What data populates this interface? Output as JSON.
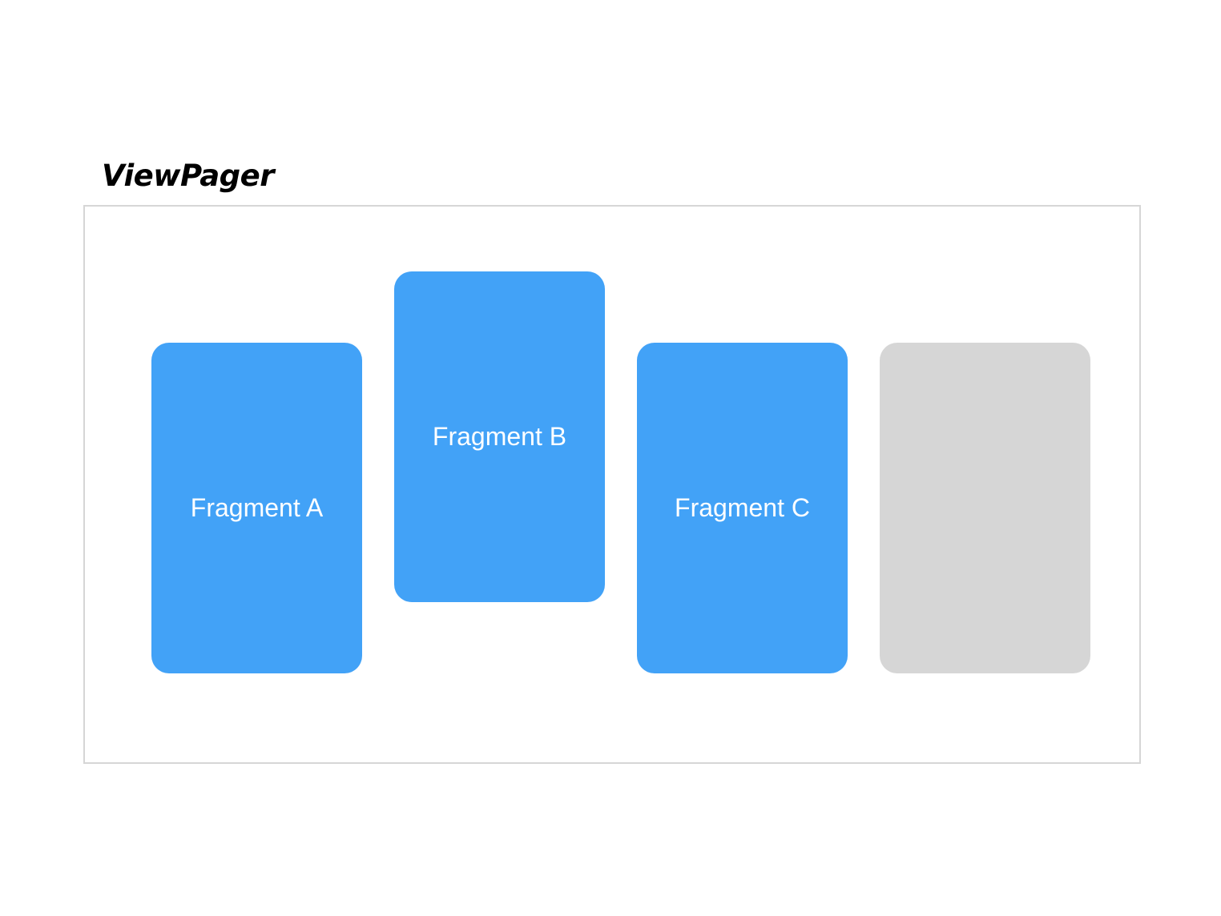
{
  "title": "ViewPager",
  "colors": {
    "active_fragment": "#42a2f7",
    "inactive_fragment": "#d6d6d6",
    "frame_border": "#d6d6d6",
    "label_text": "#ffffff"
  },
  "fragments": [
    {
      "label": "Fragment A",
      "state": "active"
    },
    {
      "label": "Fragment B",
      "state": "active"
    },
    {
      "label": "Fragment C",
      "state": "active"
    },
    {
      "label": "",
      "state": "inactive"
    }
  ]
}
